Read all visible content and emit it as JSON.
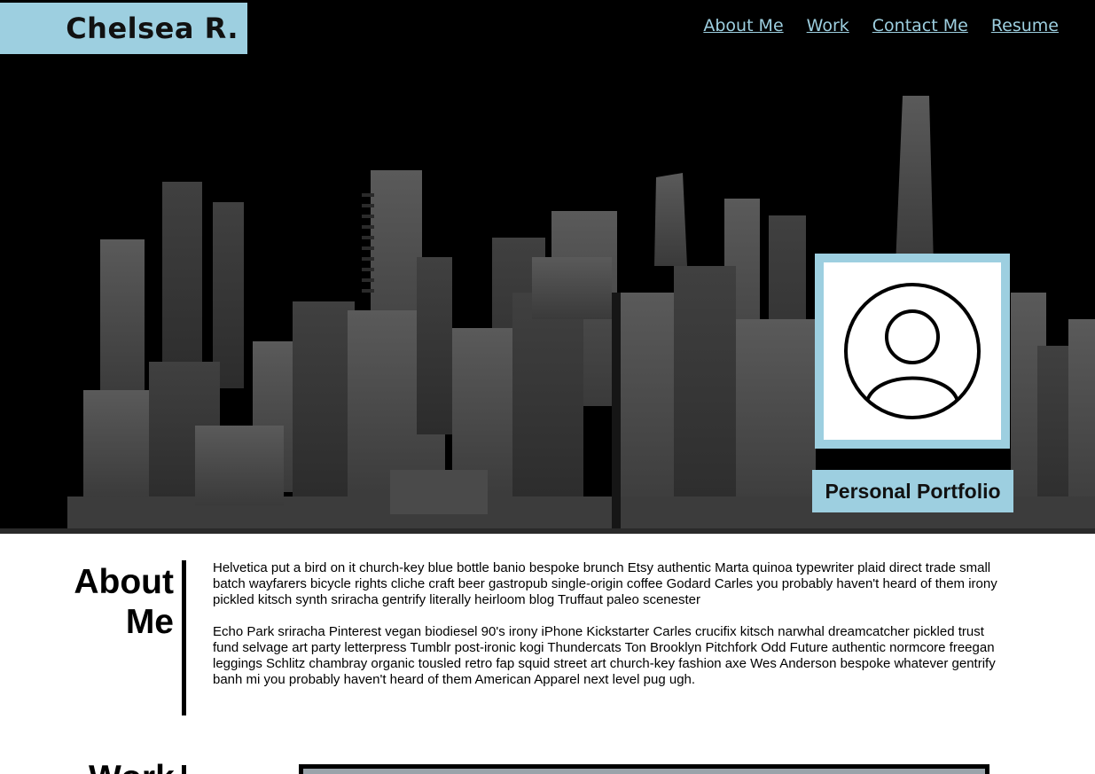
{
  "header": {
    "brand": "Chelsea R.",
    "nav": [
      "About Me",
      "Work",
      "Contact Me",
      "Resume"
    ]
  },
  "hero": {
    "tagline": "Personal Portfolio",
    "avatar_icon": "user-circle-icon",
    "background": "city-skyline-image"
  },
  "about": {
    "heading_line1": "About",
    "heading_line2": "Me",
    "paragraphs": [
      "Helvetica put a bird on it church-key blue bottle banio bespoke brunch Etsy authentic Marta quinoa typewriter plaid direct trade small batch wayfarers bicycle rights cliche craft beer gastropub single-origin coffee Godard Carles you probably haven't heard of them irony pickled kitsch synth sriracha gentrify literally heirloom blog Truffaut paleo scenester",
      "Echo Park sriracha Pinterest vegan biodiesel 90's irony iPhone Kickstarter Carles crucifix kitsch narwhal dreamcatcher pickled trust fund selvage art party letterpress Tumblr post-ironic kogi Thundercats Ton Brooklyn Pitchfork Odd Future authentic normcore freegan leggings Schlitz chambray organic tousled retro fap squid street art church-key fashion axe Wes Anderson bespoke whatever gentrify banh mi you probably haven't heard of them American Apparel next level pug ugh."
    ]
  },
  "work": {
    "heading": "Work"
  },
  "colors": {
    "accent": "#9dcfe0",
    "hero_bg": "#000000",
    "text": "#000000"
  }
}
